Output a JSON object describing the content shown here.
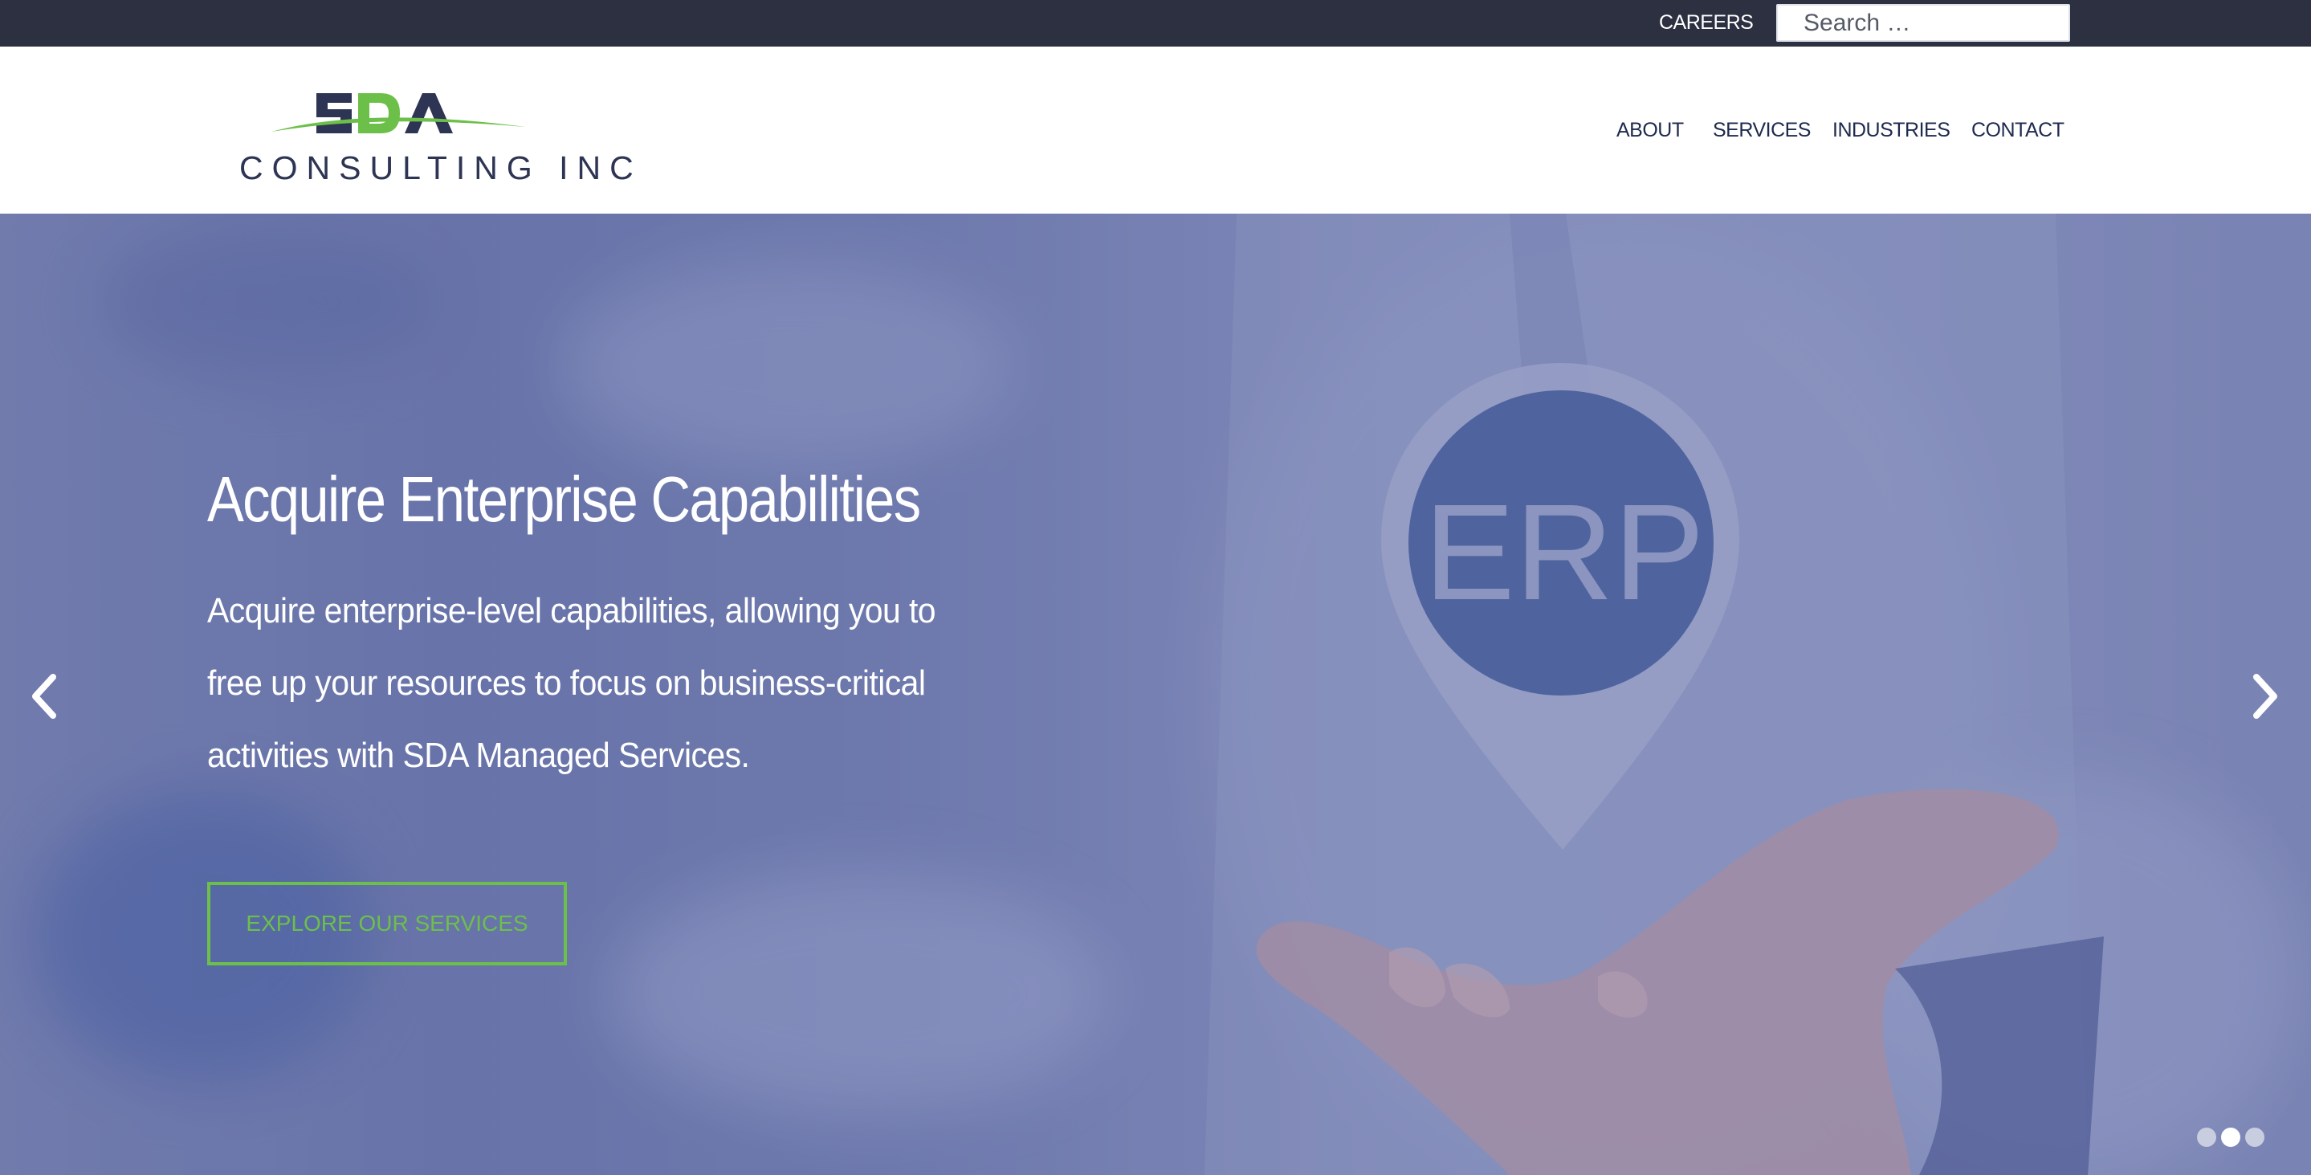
{
  "topbar": {
    "careers_label": "CAREERS",
    "search_placeholder": "Search …"
  },
  "header": {
    "logo_text": "SDA",
    "logo_tagline": "CONSULTING INC",
    "nav": {
      "about": "ABOUT",
      "services": "SERVICES",
      "industries": "INDUSTRIES",
      "contact": "CONTACT"
    }
  },
  "hero": {
    "title": "Acquire Enterprise Capabilities",
    "text": "Acquire enterprise-level capabilities, allowing you to free up your resources to focus on business-critical activities with SDA Managed Services.",
    "button_label": "EXPLORE OUR SERVICES",
    "pin_label": "ERP",
    "slides_total": 3,
    "active_slide": 2
  },
  "colors": {
    "topbar_bg": "#2c3040",
    "brand_navy": "#2e3453",
    "brand_green": "#6cc04a",
    "nav_text": "#1e2a4e"
  },
  "icons": {
    "prev": "chevron-left-icon",
    "next": "chevron-right-icon"
  }
}
